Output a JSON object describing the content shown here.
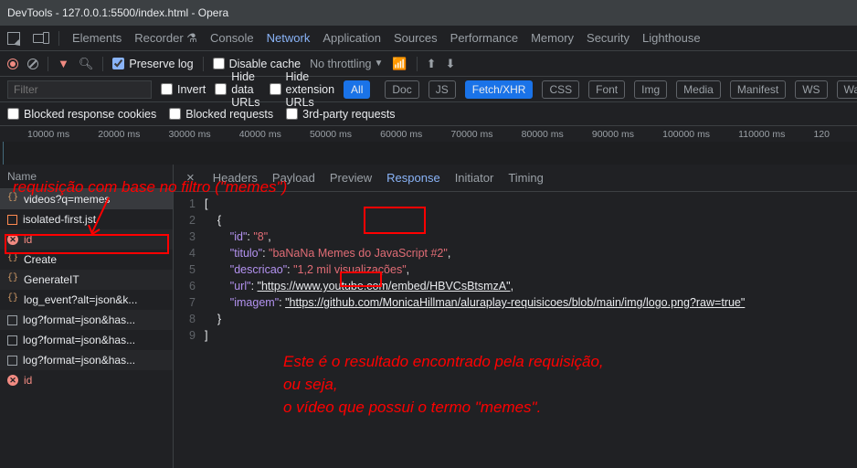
{
  "window": {
    "title": "DevTools - 127.0.0.1:5500/index.html - Opera"
  },
  "menubar": {
    "tabs": {
      "elements": "Elements",
      "recorder": "Recorder",
      "console": "Console",
      "network": "Network",
      "application": "Application",
      "sources": "Sources",
      "performance": "Performance",
      "memory": "Memory",
      "security": "Security",
      "lighthouse": "Lighthouse"
    },
    "activeTab": "network"
  },
  "toolbar": {
    "preserve_log": "Preserve log",
    "disable_cache": "Disable cache",
    "throttling": "No throttling"
  },
  "filterbar": {
    "placeholder": "Filter",
    "invert": "Invert",
    "hide_data": "Hide data URLs",
    "hide_ext": "Hide extension URLs",
    "pills": {
      "all": "All",
      "doc": "Doc",
      "js": "JS",
      "fetch": "Fetch/XHR",
      "css": "CSS",
      "font": "Font",
      "img": "Img",
      "media": "Media",
      "manifest": "Manifest",
      "ws": "WS",
      "wasm": "Wa"
    }
  },
  "filterbar2": {
    "blocked_cookies": "Blocked response cookies",
    "blocked_req": "Blocked requests",
    "third_party": "3rd-party requests"
  },
  "timeline": {
    "ticks": [
      "10000 ms",
      "20000 ms",
      "30000 ms",
      "40000 ms",
      "50000 ms",
      "60000 ms",
      "70000 ms",
      "80000 ms",
      "90000 ms",
      "100000 ms",
      "110000 ms",
      "120"
    ]
  },
  "requests": {
    "header": "Name",
    "items": [
      {
        "name": "videos?q=memes",
        "icon": "fetch",
        "sel": true,
        "err": false
      },
      {
        "name": "isolated-first.jst",
        "icon": "js",
        "sel": false,
        "err": false
      },
      {
        "name": "id",
        "icon": "err",
        "sel": false,
        "err": true
      },
      {
        "name": "Create",
        "icon": "fetch",
        "sel": false,
        "err": false
      },
      {
        "name": "GenerateIT",
        "icon": "fetch",
        "sel": false,
        "err": false
      },
      {
        "name": "log_event?alt=json&k...",
        "icon": "fetch",
        "sel": false,
        "err": false
      },
      {
        "name": "log?format=json&has...",
        "icon": "doc",
        "sel": false,
        "err": false
      },
      {
        "name": "log?format=json&has...",
        "icon": "doc",
        "sel": false,
        "err": false
      },
      {
        "name": "log?format=json&has...",
        "icon": "doc",
        "sel": false,
        "err": false
      },
      {
        "name": "id",
        "icon": "err",
        "sel": false,
        "err": true
      }
    ]
  },
  "detail": {
    "tabs": {
      "headers": "Headers",
      "payload": "Payload",
      "preview": "Preview",
      "response": "Response",
      "initiator": "Initiator",
      "timing": "Timing"
    },
    "lines": [
      "1",
      "2",
      "3",
      "4",
      "5",
      "6",
      "7",
      "8",
      "9"
    ],
    "json": {
      "id_k": "\"id\"",
      "id_v": "\"8\"",
      "titulo_k": "\"titulo\"",
      "titulo_pre": "\"baNaNa ",
      "titulo_hl": "Memes",
      "titulo_post": " do JavaScript #2\"",
      "desc_k": "\"descricao\"",
      "desc_v": "\"1,2 mil visualizações\"",
      "url_k": "\"url\"",
      "url_v": "\"https://www.youtube.com/embed/HBVCsBtsmzA\"",
      "img_k": "\"imagem\"",
      "img_v": "\"https://github.com/MonicaHillman/aluraplay-requisicoes/blob/main/img/logo.png?raw=true\""
    }
  },
  "annotations": {
    "a1": "requisição com base no filtro (\"memes\")",
    "a2": "Este é o resultado encontrado pela requisição,",
    "a3": "ou seja,",
    "a4": "o vídeo que possui o termo \"memes\"."
  }
}
